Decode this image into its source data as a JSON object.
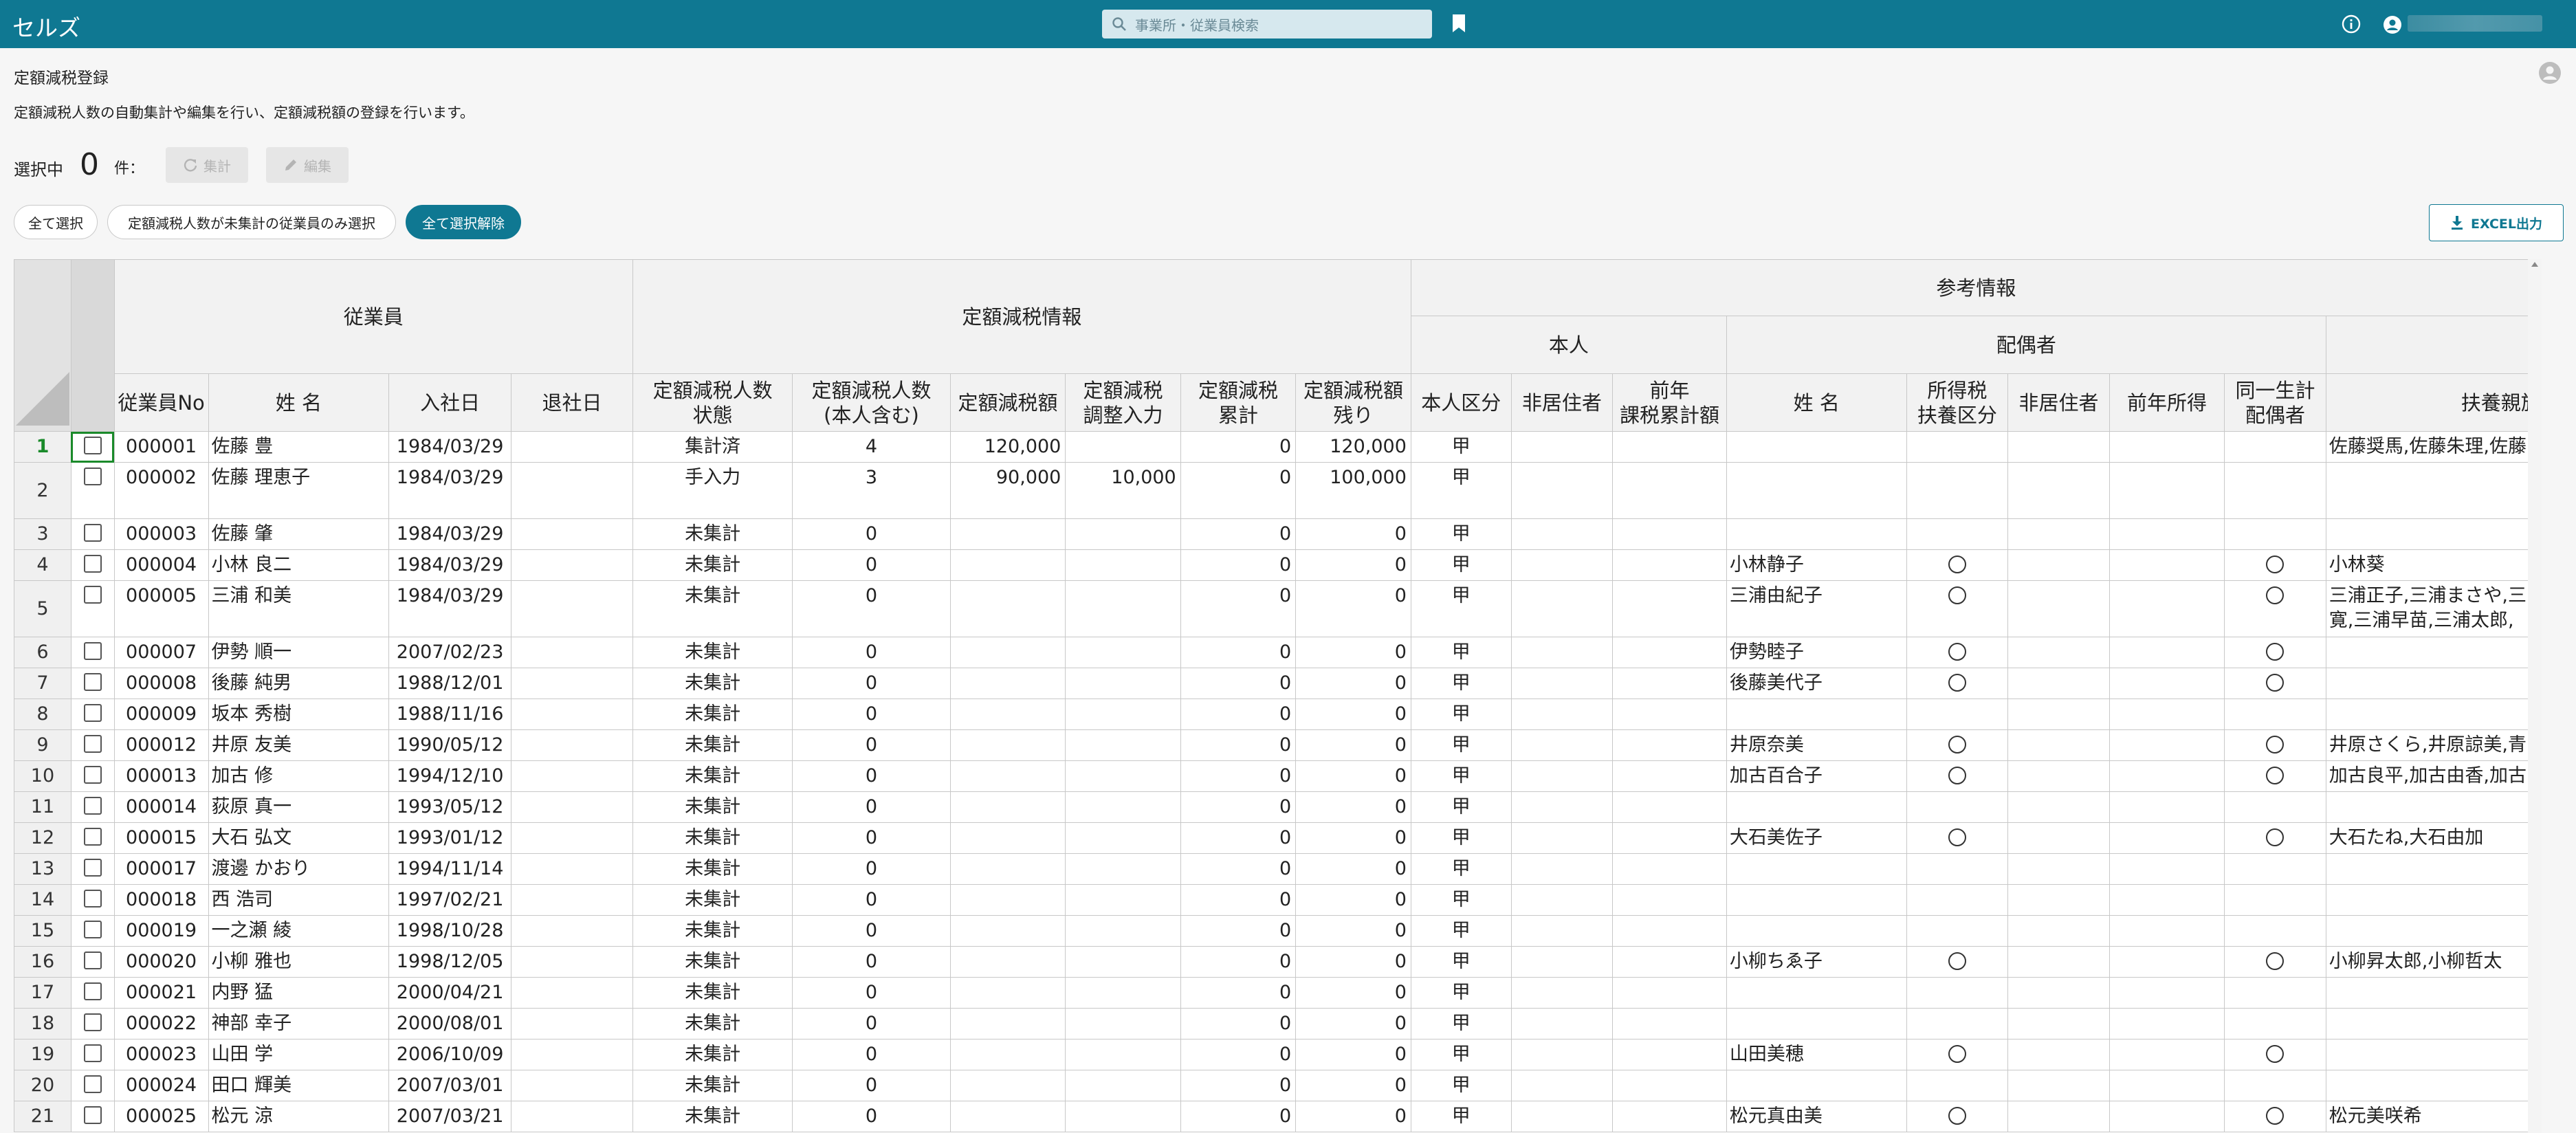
{
  "app": {
    "name": "セルズ"
  },
  "search": {
    "placeholder": "事業所・従業員検索"
  },
  "page": {
    "title": "定額減税登録",
    "description": "定額減税人数の自動集計や編集を行い、定額減税額の登録を行います。"
  },
  "selection": {
    "label": "選択中",
    "count": "0",
    "unit": "件：",
    "aggregate_label": "集計",
    "edit_label": "編集"
  },
  "filters": {
    "select_all": "全て選択",
    "select_unaggregated": "定額減税人数が未集計の従業員のみ選択",
    "deselect_all": "全て選択解除"
  },
  "export": {
    "label": "EXCEL出力"
  },
  "columns": {
    "group_employee": "従業員",
    "group_tax": "定額減税情報",
    "group_reference": "参考情報",
    "sub_self": "本人",
    "sub_spouse": "配偶者",
    "emp_no": "従業員No",
    "name": "姓 名",
    "hire_date": "入社日",
    "leave_date": "退社日",
    "status_1": "定額減税人数",
    "status_2": "状態",
    "count_1": "定額減税人数",
    "count_2": "(本人含む)",
    "amount": "定額減税額",
    "adjust_1": "定額減税",
    "adjust_2": "調整入力",
    "cumulative_1": "定額減税",
    "cumulative_2": "累計",
    "remaining_1": "定額減税額",
    "remaining_2": "残り",
    "self_class": "本人区分",
    "nonresident": "非居住者",
    "prev_year_1": "前年",
    "prev_year_2": "課税累計額",
    "spouse_name": "姓 名",
    "income_tax_1": "所得税",
    "income_tax_2": "扶養区分",
    "spouse_nonresident": "非居住者",
    "prev_income": "前年所得",
    "same_household_1": "同一生計",
    "same_household_2": "配偶者",
    "dependents": "扶養親族"
  },
  "rows": [
    {
      "rn": "1",
      "no": "000001",
      "name": "佐藤 豊",
      "hire": "1984/03/29",
      "status": "集計済",
      "count": "4",
      "amount": "120,000",
      "adjust": "",
      "cum": "0",
      "rem": "120,000",
      "cls": "甲",
      "spouse": "",
      "inc": "",
      "same": "",
      "dep": "佐藤奨馬,佐藤朱理,佐藤"
    },
    {
      "rn": "2",
      "no": "000002",
      "name": "佐藤 理恵子",
      "hire": "1984/03/29",
      "status": "手入力",
      "count": "3",
      "amount": "90,000",
      "adjust": "10,000",
      "cum": "0",
      "rem": "100,000",
      "cls": "甲",
      "spouse": "",
      "inc": "",
      "same": "",
      "dep": ""
    },
    {
      "rn": "3",
      "no": "000003",
      "name": "佐藤 肇",
      "hire": "1984/03/29",
      "status": "未集計",
      "count": "0",
      "amount": "",
      "adjust": "",
      "cum": "0",
      "rem": "0",
      "cls": "甲",
      "spouse": "",
      "inc": "",
      "same": "",
      "dep": ""
    },
    {
      "rn": "4",
      "no": "000004",
      "name": "小林 良二",
      "hire": "1984/03/29",
      "status": "未集計",
      "count": "0",
      "amount": "",
      "adjust": "",
      "cum": "0",
      "rem": "0",
      "cls": "甲",
      "spouse": "小林静子",
      "inc": "○",
      "same": "○",
      "dep": "小林葵"
    },
    {
      "rn": "5",
      "no": "000005",
      "name": "三浦 和美",
      "hire": "1984/03/29",
      "status": "未集計",
      "count": "0",
      "amount": "",
      "adjust": "",
      "cum": "0",
      "rem": "0",
      "cls": "甲",
      "spouse": "三浦由紀子",
      "inc": "○",
      "same": "○",
      "dep": "三浦正子,三浦まさや,三",
      "dep2": "寛,三浦早苗,三浦太郎,"
    },
    {
      "rn": "6",
      "no": "000007",
      "name": "伊勢 順一",
      "hire": "2007/02/23",
      "status": "未集計",
      "count": "0",
      "amount": "",
      "adjust": "",
      "cum": "0",
      "rem": "0",
      "cls": "甲",
      "spouse": "伊勢睦子",
      "inc": "○",
      "same": "○",
      "dep": ""
    },
    {
      "rn": "7",
      "no": "000008",
      "name": "後藤 純男",
      "hire": "1988/12/01",
      "status": "未集計",
      "count": "0",
      "amount": "",
      "adjust": "",
      "cum": "0",
      "rem": "0",
      "cls": "甲",
      "spouse": "後藤美代子",
      "inc": "○",
      "same": "○",
      "dep": ""
    },
    {
      "rn": "8",
      "no": "000009",
      "name": "坂本 秀樹",
      "hire": "1988/11/16",
      "status": "未集計",
      "count": "0",
      "amount": "",
      "adjust": "",
      "cum": "0",
      "rem": "0",
      "cls": "甲",
      "spouse": "",
      "inc": "",
      "same": "",
      "dep": ""
    },
    {
      "rn": "9",
      "no": "000012",
      "name": "井原 友美",
      "hire": "1990/05/12",
      "status": "未集計",
      "count": "0",
      "amount": "",
      "adjust": "",
      "cum": "0",
      "rem": "0",
      "cls": "甲",
      "spouse": "井原奈美",
      "inc": "○",
      "same": "○",
      "dep": "井原さくら,井原諒美,青"
    },
    {
      "rn": "10",
      "no": "000013",
      "name": "加古 修",
      "hire": "1994/12/10",
      "status": "未集計",
      "count": "0",
      "amount": "",
      "adjust": "",
      "cum": "0",
      "rem": "0",
      "cls": "甲",
      "spouse": "加古百合子",
      "inc": "○",
      "same": "○",
      "dep": "加古良平,加古由香,加古"
    },
    {
      "rn": "11",
      "no": "000014",
      "name": "荻原 真一",
      "hire": "1993/05/12",
      "status": "未集計",
      "count": "0",
      "amount": "",
      "adjust": "",
      "cum": "0",
      "rem": "0",
      "cls": "甲",
      "spouse": "",
      "inc": "",
      "same": "",
      "dep": ""
    },
    {
      "rn": "12",
      "no": "000015",
      "name": "大石 弘文",
      "hire": "1993/01/12",
      "status": "未集計",
      "count": "0",
      "amount": "",
      "adjust": "",
      "cum": "0",
      "rem": "0",
      "cls": "甲",
      "spouse": "大石美佐子",
      "inc": "○",
      "same": "○",
      "dep": "大石たね,大石由加"
    },
    {
      "rn": "13",
      "no": "000017",
      "name": "渡邊 かおり",
      "hire": "1994/11/14",
      "status": "未集計",
      "count": "0",
      "amount": "",
      "adjust": "",
      "cum": "0",
      "rem": "0",
      "cls": "甲",
      "spouse": "",
      "inc": "",
      "same": "",
      "dep": ""
    },
    {
      "rn": "14",
      "no": "000018",
      "name": "西 浩司",
      "hire": "1997/02/21",
      "status": "未集計",
      "count": "0",
      "amount": "",
      "adjust": "",
      "cum": "0",
      "rem": "0",
      "cls": "甲",
      "spouse": "",
      "inc": "",
      "same": "",
      "dep": ""
    },
    {
      "rn": "15",
      "no": "000019",
      "name": "一之瀬 綾",
      "hire": "1998/10/28",
      "status": "未集計",
      "count": "0",
      "amount": "",
      "adjust": "",
      "cum": "0",
      "rem": "0",
      "cls": "甲",
      "spouse": "",
      "inc": "",
      "same": "",
      "dep": ""
    },
    {
      "rn": "16",
      "no": "000020",
      "name": "小柳 雅也",
      "hire": "1998/12/05",
      "status": "未集計",
      "count": "0",
      "amount": "",
      "adjust": "",
      "cum": "0",
      "rem": "0",
      "cls": "甲",
      "spouse": "小柳ちゑ子",
      "inc": "○",
      "same": "○",
      "dep": "小柳昇太郎,小柳哲太"
    },
    {
      "rn": "17",
      "no": "000021",
      "name": "内野 猛",
      "hire": "2000/04/21",
      "status": "未集計",
      "count": "0",
      "amount": "",
      "adjust": "",
      "cum": "0",
      "rem": "0",
      "cls": "甲",
      "spouse": "",
      "inc": "",
      "same": "",
      "dep": ""
    },
    {
      "rn": "18",
      "no": "000022",
      "name": "神部 幸子",
      "hire": "2000/08/01",
      "status": "未集計",
      "count": "0",
      "amount": "",
      "adjust": "",
      "cum": "0",
      "rem": "0",
      "cls": "甲",
      "spouse": "",
      "inc": "",
      "same": "",
      "dep": ""
    },
    {
      "rn": "19",
      "no": "000023",
      "name": "山田 学",
      "hire": "2006/10/09",
      "status": "未集計",
      "count": "0",
      "amount": "",
      "adjust": "",
      "cum": "0",
      "rem": "0",
      "cls": "甲",
      "spouse": "山田美穂",
      "inc": "○",
      "same": "○",
      "dep": ""
    },
    {
      "rn": "20",
      "no": "000024",
      "name": "田口 輝美",
      "hire": "2007/03/01",
      "status": "未集計",
      "count": "0",
      "amount": "",
      "adjust": "",
      "cum": "0",
      "rem": "0",
      "cls": "甲",
      "spouse": "",
      "inc": "",
      "same": "",
      "dep": ""
    },
    {
      "rn": "21",
      "no": "000025",
      "name": "松元 涼",
      "hire": "2007/03/21",
      "status": "未集計",
      "count": "0",
      "amount": "",
      "adjust": "",
      "cum": "0",
      "rem": "0",
      "cls": "甲",
      "spouse": "松元真由美",
      "inc": "○",
      "same": "○",
      "dep": "松元美咲希"
    }
  ]
}
